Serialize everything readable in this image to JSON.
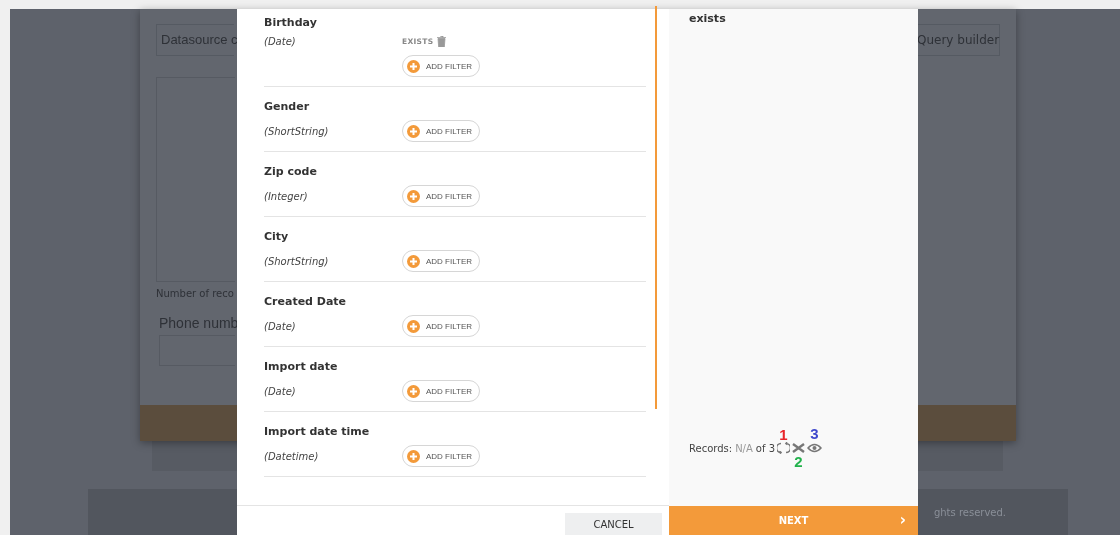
{
  "background_page": {
    "datasource_field": "Datasource c",
    "query_builder_button": "Query builder",
    "records_note": "Number of reco",
    "phone_label": "Phone numb",
    "footer_text": "ghts reserved."
  },
  "fields": [
    {
      "name": "Birthday",
      "type": "(Date)",
      "filters": [
        {
          "operator": "EXISTS"
        }
      ],
      "add_filter": "ADD FILTER"
    },
    {
      "name": "Gender",
      "type": "(ShortString)",
      "add_filter": "ADD FILTER"
    },
    {
      "name": "Zip code",
      "type": "(Integer)",
      "add_filter": "ADD FILTER"
    },
    {
      "name": "City",
      "type": "(ShortString)",
      "add_filter": "ADD FILTER"
    },
    {
      "name": "Created Date",
      "type": "(Date)",
      "add_filter": "ADD FILTER"
    },
    {
      "name": "Import date",
      "type": "(Date)",
      "add_filter": "ADD FILTER"
    },
    {
      "name": "Import date time",
      "type": "(Datetime)",
      "add_filter": "ADD FILTER"
    }
  ],
  "preview": {
    "text": "exists",
    "records_label": "Records:",
    "records_value": "N/A",
    "records_total": "of 3",
    "markers": [
      {
        "label": "1",
        "color": "#e8262b"
      },
      {
        "label": "2",
        "color": "#22b24c"
      },
      {
        "label": "3",
        "color": "#3f48cc"
      }
    ]
  },
  "buttons": {
    "cancel": "CANCEL",
    "next": "NEXT",
    "next_icon": "›"
  }
}
